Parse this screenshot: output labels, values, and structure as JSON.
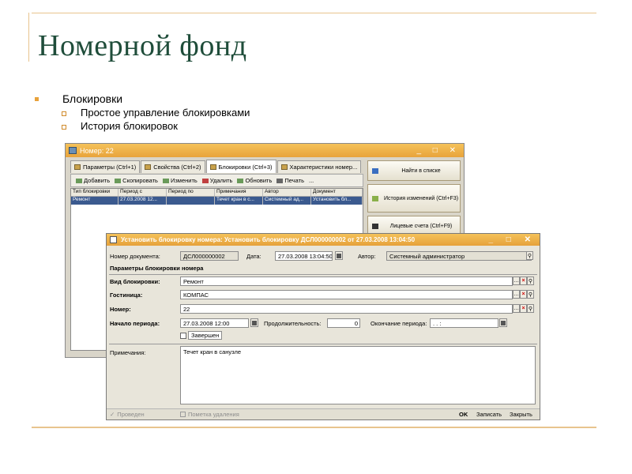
{
  "slide": {
    "title": "Номерной фонд",
    "bullet": "Блокировки",
    "sub_bullets": [
      "Простое управление блокировками",
      "История блокировок"
    ]
  },
  "back_window": {
    "title": "Номер: 22",
    "tabs": [
      "Параметры (Ctrl+1)",
      "Свойства (Ctrl+2)",
      "Блокировки (Ctrl+3)",
      "Характеристики номер..."
    ],
    "toolbar": [
      "Добавить",
      "Скопировать",
      "Изменить",
      "Удалить",
      "Обновить",
      "Печать",
      "..."
    ],
    "table_headers": [
      "Тип блокировки",
      "Период с",
      "Период по",
      "Примечания",
      "Автор",
      "Документ"
    ],
    "table_rows": [
      [
        "Ремонт",
        "27.03.2008 12...",
        "",
        "Течет кран в с...",
        "Системный ад...",
        "Установить бл..."
      ]
    ],
    "side_buttons": [
      "Найти в списке",
      "История изменений (Ctrl+F3)",
      "Лицевые счета (Ctrl+F9)"
    ]
  },
  "dialog": {
    "title": "Установить блокировку номера: Установить блокировку ДСЛ000000002 от 27.03.2008 13:04:50",
    "doc_number_label": "Номер документа:",
    "doc_number": "ДСЛ000000002",
    "date_label": "Дата:",
    "date": "27.03.2008 13:04:50",
    "author_label": "Автор:",
    "author": "Системный администратор",
    "section": "Параметры блокировки номера",
    "block_type_label": "Вид блокировки:",
    "block_type": "Ремонт",
    "hotel_label": "Гостиница:",
    "hotel": "КОМПАС",
    "room_label": "Номер:",
    "room": "22",
    "period_start_label": "Начало периода:",
    "period_start": "27.03.2008 12:00",
    "duration_label": "Продолжительность:",
    "duration": "0",
    "period_end_label": "Окончание периода:",
    "period_end": " .  .       :",
    "completed_label": "Завершен",
    "notes_label": "Примечания:",
    "notes": "Течет кран в санузле",
    "posted_label": "Проведен",
    "deletion_label": "Пометка удаления",
    "ok": "OK",
    "save": "Записать",
    "close": "Закрыть"
  }
}
